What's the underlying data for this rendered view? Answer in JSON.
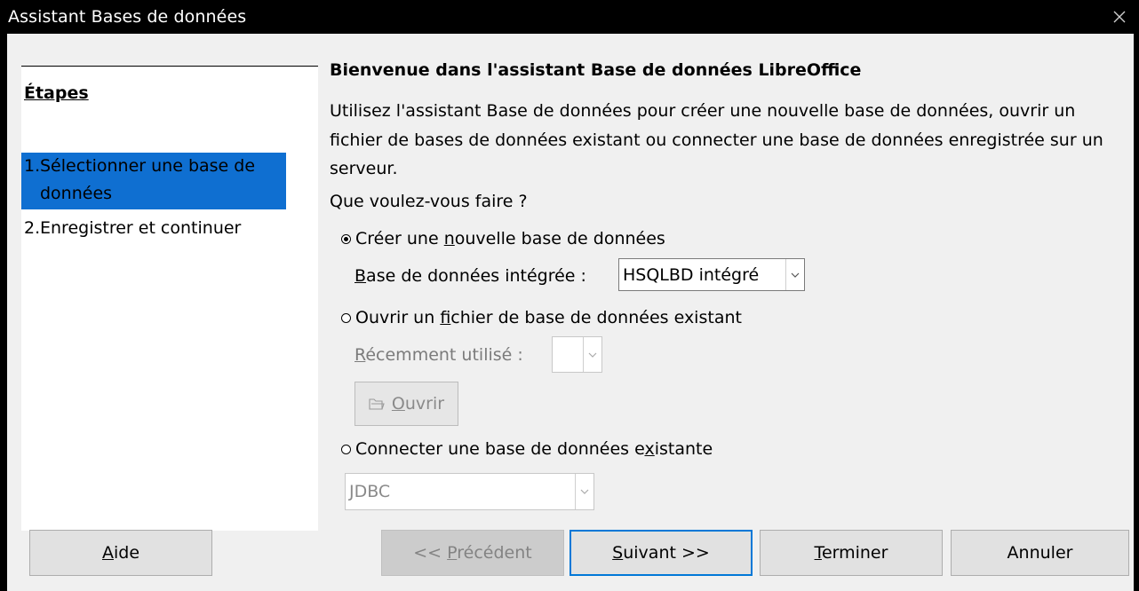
{
  "window": {
    "title": "Assistant Bases de données",
    "close_glyph": "×"
  },
  "sidebar": {
    "title": "Étapes",
    "steps": [
      {
        "number": "1.",
        "label": "Sélectionner une base de données"
      },
      {
        "number": "2.",
        "label": "Enregistrer et continuer"
      }
    ]
  },
  "main": {
    "heading": "Bienvenue dans l'assistant Base de données LibreOffice",
    "intro": "Utilisez l'assistant Base de données pour créer une nouvelle base de données, ouvrir un fichier de bases de données existant ou connecter une base de données enregistrée sur un serveur.",
    "question": "Que voulez-vous faire ?",
    "options": {
      "create": {
        "label_before": "Créer une ",
        "label_accel": "n",
        "label_after": "ouvelle base de données",
        "selected": true
      },
      "embedded": {
        "label_accel": "B",
        "label_after": "ase de données intégrée :",
        "value": "HSQLBD intégré"
      },
      "open": {
        "label_before": "Ouvrir un ",
        "label_accel": "f",
        "label_after": "ichier de base de données existant",
        "selected": false
      },
      "recent": {
        "label_accel": "R",
        "label_after": "écemment utilisé :",
        "value": ""
      },
      "open_button": {
        "label_accel": "O",
        "label_after": "uvrir"
      },
      "connect": {
        "label_before": "Connecter une base de données e",
        "label_accel": "x",
        "label_after": "istante",
        "selected": false
      },
      "connection_type": {
        "value": "JDBC"
      }
    }
  },
  "footer": {
    "help": {
      "accel": "A",
      "rest": "ide"
    },
    "previous": {
      "before": "<< ",
      "accel": "P",
      "rest": "récédent"
    },
    "next": {
      "accel": "S",
      "rest": "uivant >>"
    },
    "finish": {
      "accel": "T",
      "rest": "erminer"
    },
    "cancel": {
      "label": "Annuler"
    }
  },
  "colors": {
    "title_bar": "#000000",
    "selection": "#0f6fd1",
    "default_button_border": "#0078d7"
  },
  "icons": {
    "close": "close-icon",
    "dropdown": "chevron-down-icon",
    "open_folder": "open-folder-icon"
  }
}
